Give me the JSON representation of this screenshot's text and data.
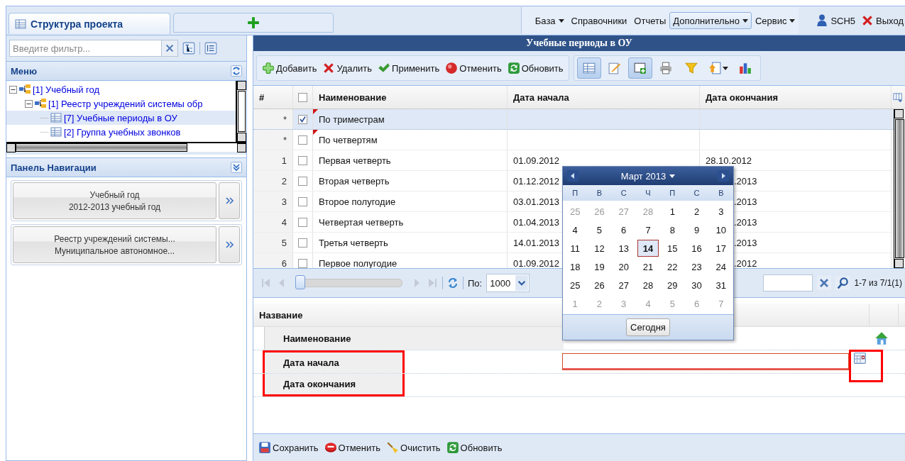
{
  "project_tab": {
    "label": "Структура проекта",
    "selected": true
  },
  "top_menu": [
    {
      "label": "База",
      "dropdown": true,
      "selected": false
    },
    {
      "label": "Справочники",
      "dropdown": false,
      "selected": false
    },
    {
      "label": "Отчеты",
      "dropdown": false,
      "selected": false
    },
    {
      "label": "Дополнительно",
      "dropdown": true,
      "selected": true
    },
    {
      "label": "Сервис",
      "dropdown": true,
      "selected": false
    }
  ],
  "user": {
    "name": "SCH5",
    "logout": "Выход"
  },
  "filter": {
    "placeholder": "Введите фильтр..."
  },
  "menu_panel": {
    "title": "Меню",
    "tree": [
      {
        "label": "[1] Учебный год",
        "kind": "folder",
        "expanded": true,
        "selected": false,
        "children": [
          {
            "label": "[1] Реестр учреждений системы обр",
            "kind": "folder",
            "expanded": true,
            "selected": false,
            "children": [
              {
                "label": "[7] Учебные периоды в ОУ",
                "kind": "table",
                "selected": true
              },
              {
                "label": "[2] Группа учебных звонков",
                "kind": "table",
                "selected": false
              }
            ]
          }
        ]
      }
    ]
  },
  "nav_panel": {
    "title": "Панель Навигации",
    "items": [
      {
        "line1": "Учебный год",
        "line2": "2012-2013 учебный год"
      },
      {
        "line1": "Реестр учреждений системы...",
        "line2": "Муниципальное автономное..."
      }
    ]
  },
  "main": {
    "title": "Учебные периоды в ОУ",
    "toolbar": [
      {
        "kind": "add",
        "label": "Добавить"
      },
      {
        "kind": "delete",
        "label": "Удалить"
      },
      {
        "kind": "apply",
        "label": "Применить"
      },
      {
        "kind": "cancel",
        "label": "Отменить"
      },
      {
        "kind": "refresh",
        "label": "Обновить"
      }
    ],
    "tool_icons": [
      {
        "kind": "grid",
        "selected": true
      },
      {
        "kind": "edit",
        "selected": false
      },
      {
        "kind": "form",
        "selected": true
      },
      {
        "kind": "print",
        "selected": false
      },
      {
        "kind": "filter",
        "selected": false
      },
      {
        "kind": "export",
        "selected": false
      },
      {
        "kind": "chart",
        "selected": false
      }
    ],
    "table": {
      "columns": [
        "#",
        "Наименование",
        "Дата начала",
        "Дата окончания"
      ],
      "all_checked": false,
      "rows": [
        {
          "num": "*",
          "checked": true,
          "selected": true,
          "modified": true,
          "name": "По триместрам"
        },
        {
          "num": "*",
          "checked": false,
          "selected": false,
          "modified": true,
          "name": "По четвертям"
        },
        {
          "num": "1",
          "checked": false,
          "selected": false,
          "modified": false,
          "name": "Первая четверть",
          "start": "01.09.2012",
          "end": "28.10.2012"
        },
        {
          "num": "2",
          "checked": false,
          "selected": false,
          "modified": false,
          "name": "Вторая четверть",
          "start": "01.12.2012",
          "end": ".2013"
        },
        {
          "num": "3",
          "checked": false,
          "selected": false,
          "modified": false,
          "name": "Второе полугодие",
          "start": "03.01.2013",
          "end": ".2013"
        },
        {
          "num": "4",
          "checked": false,
          "selected": false,
          "modified": false,
          "name": "Четвертая четверть",
          "start": "01.04.2013",
          "end": ".2013"
        },
        {
          "num": "5",
          "checked": false,
          "selected": false,
          "modified": false,
          "name": "Третья четверть",
          "start": "14.01.2013",
          "end": ".2013"
        },
        {
          "num": "6",
          "checked": false,
          "selected": false,
          "modified": false,
          "name": "Первое полугодие",
          "start": "01.09.2012",
          "end": ".2012"
        }
      ]
    },
    "paging": {
      "level": 0.0,
      "per_page_label": "По:",
      "per_page": "1000",
      "summary": "1-7 из 7/1(1)"
    },
    "properties": {
      "header": "Название",
      "rows": [
        {
          "label": "Наименование",
          "kind": "text",
          "highlighted": false
        },
        {
          "label": "Дата начала",
          "kind": "date",
          "highlighted": true,
          "invalid": true,
          "trigger_highlighted": true
        },
        {
          "label": "Дата окончания",
          "kind": "text",
          "highlighted": true
        }
      ]
    },
    "bottom_toolbar": [
      {
        "kind": "save",
        "label": "Сохранить"
      },
      {
        "kind": "cancel2",
        "label": "Отменить"
      },
      {
        "kind": "clear",
        "label": "Очистить"
      },
      {
        "kind": "refresh",
        "label": "Обновить"
      }
    ]
  },
  "calendar": {
    "month": "Март 2013",
    "weekdays": [
      "П",
      "В",
      "С",
      "Ч",
      "П",
      "С",
      "В"
    ],
    "days": [
      {
        "day": "25",
        "other": true,
        "selected": false
      },
      {
        "day": "26",
        "other": true,
        "selected": false
      },
      {
        "day": "27",
        "other": true,
        "selected": false
      },
      {
        "day": "28",
        "other": true,
        "selected": false
      },
      {
        "day": "1",
        "other": false,
        "selected": false
      },
      {
        "day": "2",
        "other": false,
        "selected": false
      },
      {
        "day": "3",
        "other": false,
        "selected": false
      },
      {
        "day": "4",
        "other": false,
        "selected": false
      },
      {
        "day": "5",
        "other": false,
        "selected": false
      },
      {
        "day": "6",
        "other": false,
        "selected": false
      },
      {
        "day": "7",
        "other": false,
        "selected": false
      },
      {
        "day": "8",
        "other": false,
        "selected": false
      },
      {
        "day": "9",
        "other": false,
        "selected": false
      },
      {
        "day": "10",
        "other": false,
        "selected": false
      },
      {
        "day": "11",
        "other": false,
        "selected": false
      },
      {
        "day": "12",
        "other": false,
        "selected": false
      },
      {
        "day": "13",
        "other": false,
        "selected": false
      },
      {
        "day": "14",
        "other": false,
        "selected": true
      },
      {
        "day": "15",
        "other": false,
        "selected": false
      },
      {
        "day": "16",
        "other": false,
        "selected": false
      },
      {
        "day": "17",
        "other": false,
        "selected": false
      },
      {
        "day": "18",
        "other": false,
        "selected": false
      },
      {
        "day": "19",
        "other": false,
        "selected": false
      },
      {
        "day": "20",
        "other": false,
        "selected": false
      },
      {
        "day": "21",
        "other": false,
        "selected": false
      },
      {
        "day": "22",
        "other": false,
        "selected": false
      },
      {
        "day": "23",
        "other": false,
        "selected": false
      },
      {
        "day": "24",
        "other": false,
        "selected": false
      },
      {
        "day": "25",
        "other": false,
        "selected": false
      },
      {
        "day": "26",
        "other": false,
        "selected": false
      },
      {
        "day": "27",
        "other": false,
        "selected": false
      },
      {
        "day": "28",
        "other": false,
        "selected": false
      },
      {
        "day": "29",
        "other": false,
        "selected": false
      },
      {
        "day": "30",
        "other": false,
        "selected": false
      },
      {
        "day": "31",
        "other": false,
        "selected": false
      },
      {
        "day": "1",
        "other": true,
        "selected": false
      },
      {
        "day": "2",
        "other": true,
        "selected": false
      },
      {
        "day": "3",
        "other": true,
        "selected": false
      },
      {
        "day": "4",
        "other": true,
        "selected": false
      },
      {
        "day": "5",
        "other": true,
        "selected": false
      },
      {
        "day": "6",
        "other": true,
        "selected": false
      },
      {
        "day": "7",
        "other": true,
        "selected": false
      }
    ],
    "today": "Сегодня"
  }
}
